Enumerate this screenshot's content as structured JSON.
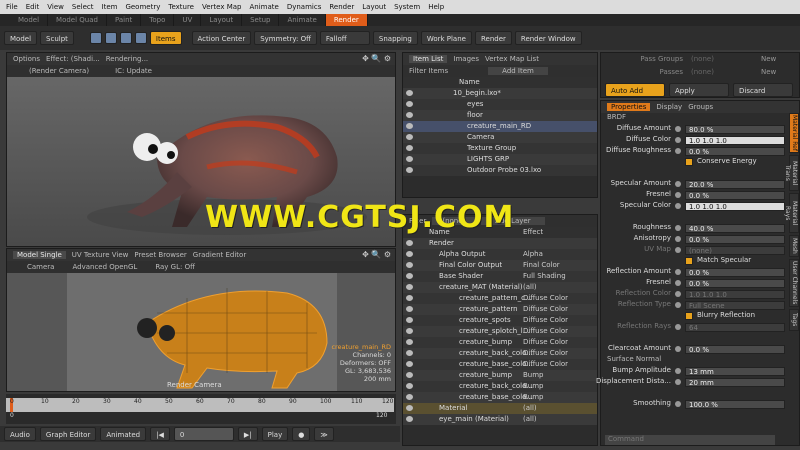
{
  "menu": [
    "File",
    "Edit",
    "View",
    "Select",
    "Item",
    "Geometry",
    "Texture",
    "Vertex Map",
    "Animate",
    "Dynamics",
    "Render",
    "Layout",
    "System",
    "Help"
  ],
  "tabs": [
    "Model",
    "Model Quad",
    "Paint",
    "Topo",
    "UV",
    "Layout",
    "Setup",
    "Animate",
    "Render"
  ],
  "toolbar": {
    "model": "Model",
    "sculpt": "Sculpt",
    "items": "Items",
    "action_center": "Action Center",
    "symmetry": "Symmetry: Off",
    "falloff": "Falloff",
    "snapping": "Snapping",
    "work_plane": "Work Plane",
    "render": "Render",
    "render_window": "Render Window"
  },
  "viewport1": {
    "tabs": [
      "Options",
      "Effect: (Shadi...",
      "Rendering..."
    ],
    "sub": [
      "(Render Camera)",
      "IC: Update"
    ]
  },
  "viewport2": {
    "tabs": [
      "Model Single",
      "UV Texture View",
      "Preset Browser",
      "Gradient Editor"
    ],
    "sub": [
      "Camera",
      "Advanced OpenGL",
      "Ray GL: Off"
    ],
    "label": "Render Camera",
    "info": [
      "creature_main_RD",
      "Channels: 0",
      "Deformers: OFF",
      "GL: 3,683,536",
      "200 mm"
    ]
  },
  "timeline": {
    "ticks": [
      "0",
      "10",
      "20",
      "30",
      "40",
      "50",
      "60",
      "70",
      "80",
      "90",
      "100",
      "110",
      "120"
    ],
    "sub_ticks": [
      "0",
      "120"
    ]
  },
  "bottom": {
    "audio": "Audio",
    "graph_editor": "Graph Editor",
    "animated": "Animated",
    "frame": "0",
    "play": "Play"
  },
  "item_list": {
    "tabs": [
      "Item List",
      "Images",
      "Vertex Map List"
    ],
    "filter": "Filter Items",
    "add": "Add Item",
    "header_name": "Name",
    "items": [
      "10_begin.lxo*",
      "eyes",
      "floor",
      "creature_main_RD",
      "Camera",
      "Texture Group",
      "LIGHTS GRP",
      "Outdoor Probe 03.lxo"
    ]
  },
  "shader": {
    "filter_label": "Filter",
    "filter_val": "(none)",
    "add_layer": "Add Layer",
    "header_name": "Name",
    "header_effect": "Effect",
    "rows": [
      {
        "name": "Render",
        "effect": ""
      },
      {
        "name": "Alpha Output",
        "effect": "Alpha"
      },
      {
        "name": "Final Color Output",
        "effect": "Final Color"
      },
      {
        "name": "Base Shader",
        "effect": "Full Shading"
      },
      {
        "name": "creature_MAT (Material)",
        "effect": "(all)"
      },
      {
        "name": "creature_pattern_c...",
        "effect": "Diffuse Color"
      },
      {
        "name": "creature_pattern",
        "effect": "Diffuse Color"
      },
      {
        "name": "creature_spots",
        "effect": "Diffuse Color"
      },
      {
        "name": "creature_splotch_l...",
        "effect": "Diffuse Color"
      },
      {
        "name": "creature_bump",
        "effect": "Diffuse Color"
      },
      {
        "name": "creature_back_colo...",
        "effect": "Diffuse Color"
      },
      {
        "name": "creature_base_colo...",
        "effect": "Diffuse Color"
      },
      {
        "name": "creature_bump",
        "effect": "Bump"
      },
      {
        "name": "creature_back_colo...",
        "effect": "Bump"
      },
      {
        "name": "creature_base_colo...",
        "effect": "Bump"
      },
      {
        "name": "Material",
        "effect": "(all)"
      },
      {
        "name": "eye_main (Material)",
        "effect": "(all)"
      }
    ]
  },
  "props_top": {
    "pass_groups": "Pass Groups",
    "passes": "Passes",
    "none": "(none)",
    "new": "New",
    "auto_add": "Auto Add",
    "apply": "Apply",
    "discard": "Discard"
  },
  "props": {
    "tabs": [
      "Properties",
      "Display",
      "Groups"
    ],
    "section_brdf": "BRDF",
    "section_surface": "Surface Normal",
    "conserve_energy": "Conserve Energy",
    "match_specular": "Match Specular",
    "blurry_reflection": "Blurry Reflection",
    "rows": [
      {
        "label": "Diffuse Amount",
        "value": "80.0 %"
      },
      {
        "label": "Diffuse Color",
        "value": "1.0    1.0    1.0"
      },
      {
        "label": "Diffuse Roughness",
        "value": "0.0 %"
      },
      {
        "label": "Specular Amount",
        "value": "20.0 %"
      },
      {
        "label": "Fresnel",
        "value": "0.0 %"
      },
      {
        "label": "Specular Color",
        "value": "1.0    1.0    1.0"
      },
      {
        "label": "Roughness",
        "value": "40.0 %"
      },
      {
        "label": "Anisotropy",
        "value": "0.0 %"
      },
      {
        "label": "UV Map",
        "value": "(none)"
      },
      {
        "label": "Reflection Amount",
        "value": "0.0 %"
      },
      {
        "label": "Fresnel",
        "value": "0.0 %"
      },
      {
        "label": "Reflection Color",
        "value": "1.0    1.0    1.0"
      },
      {
        "label": "Reflection Type",
        "value": "Full Scene"
      },
      {
        "label": "Reflection Rays",
        "value": "64"
      },
      {
        "label": "Clearcoat Amount",
        "value": "0.0 %"
      },
      {
        "label": "Bump Amplitude",
        "value": "13 mm"
      },
      {
        "label": "Displacement Dista...",
        "value": "20 mm"
      },
      {
        "label": "Smoothing",
        "value": "100.0 %"
      }
    ],
    "vtabs": [
      "Material Ref",
      "Material Trans",
      "Material Rays",
      "Mesh",
      "User Channels",
      "Tags"
    ],
    "command_placeholder": "Command"
  },
  "watermark": "WWW.CGTSJ.COM"
}
